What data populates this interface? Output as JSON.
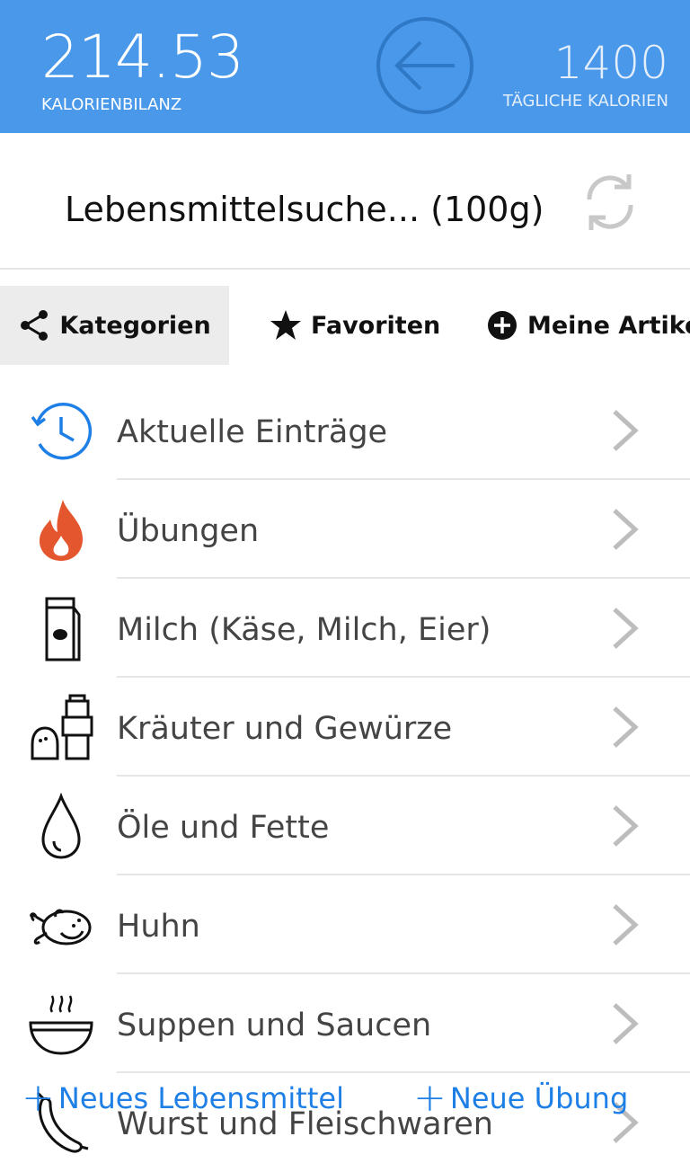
{
  "header": {
    "calorie_balance": "214.53",
    "calorie_balance_label": "KALORIENBILANZ",
    "daily_calories": "1400",
    "daily_calories_label": "TÄGLICHE KALORIEN"
  },
  "search": {
    "title": "Lebensmittelsuche... (100g)"
  },
  "tabs": [
    {
      "label": "Kategorien",
      "icon": "share-icon",
      "active": true
    },
    {
      "label": "Favoriten",
      "icon": "star-icon",
      "active": false
    },
    {
      "label": "Meine Artikel",
      "icon": "plus-circle-icon",
      "active": false
    }
  ],
  "categories": [
    {
      "label": "Aktuelle Einträge",
      "icon": "history-clock-icon"
    },
    {
      "label": "Übungen",
      "icon": "fire-icon"
    },
    {
      "label": "Milch (Käse, Milch, Eier)",
      "icon": "milk-carton-icon"
    },
    {
      "label": "Kräuter und Gewürze",
      "icon": "salt-pepper-icon"
    },
    {
      "label": "Öle und Fette",
      "icon": "oil-drop-icon"
    },
    {
      "label": "Huhn",
      "icon": "chicken-icon"
    },
    {
      "label": "Suppen und Saucen",
      "icon": "soup-bowl-icon"
    },
    {
      "label": "Wurst und Fleischwaren",
      "icon": "sausage-icon"
    }
  ],
  "actions": {
    "new_food": "Neues Lebensmittel",
    "new_exercise": "Neue Übung"
  },
  "colors": {
    "header_bg": "#4a98ea",
    "accent": "#1e7fe6",
    "fire": "#e4572e"
  }
}
